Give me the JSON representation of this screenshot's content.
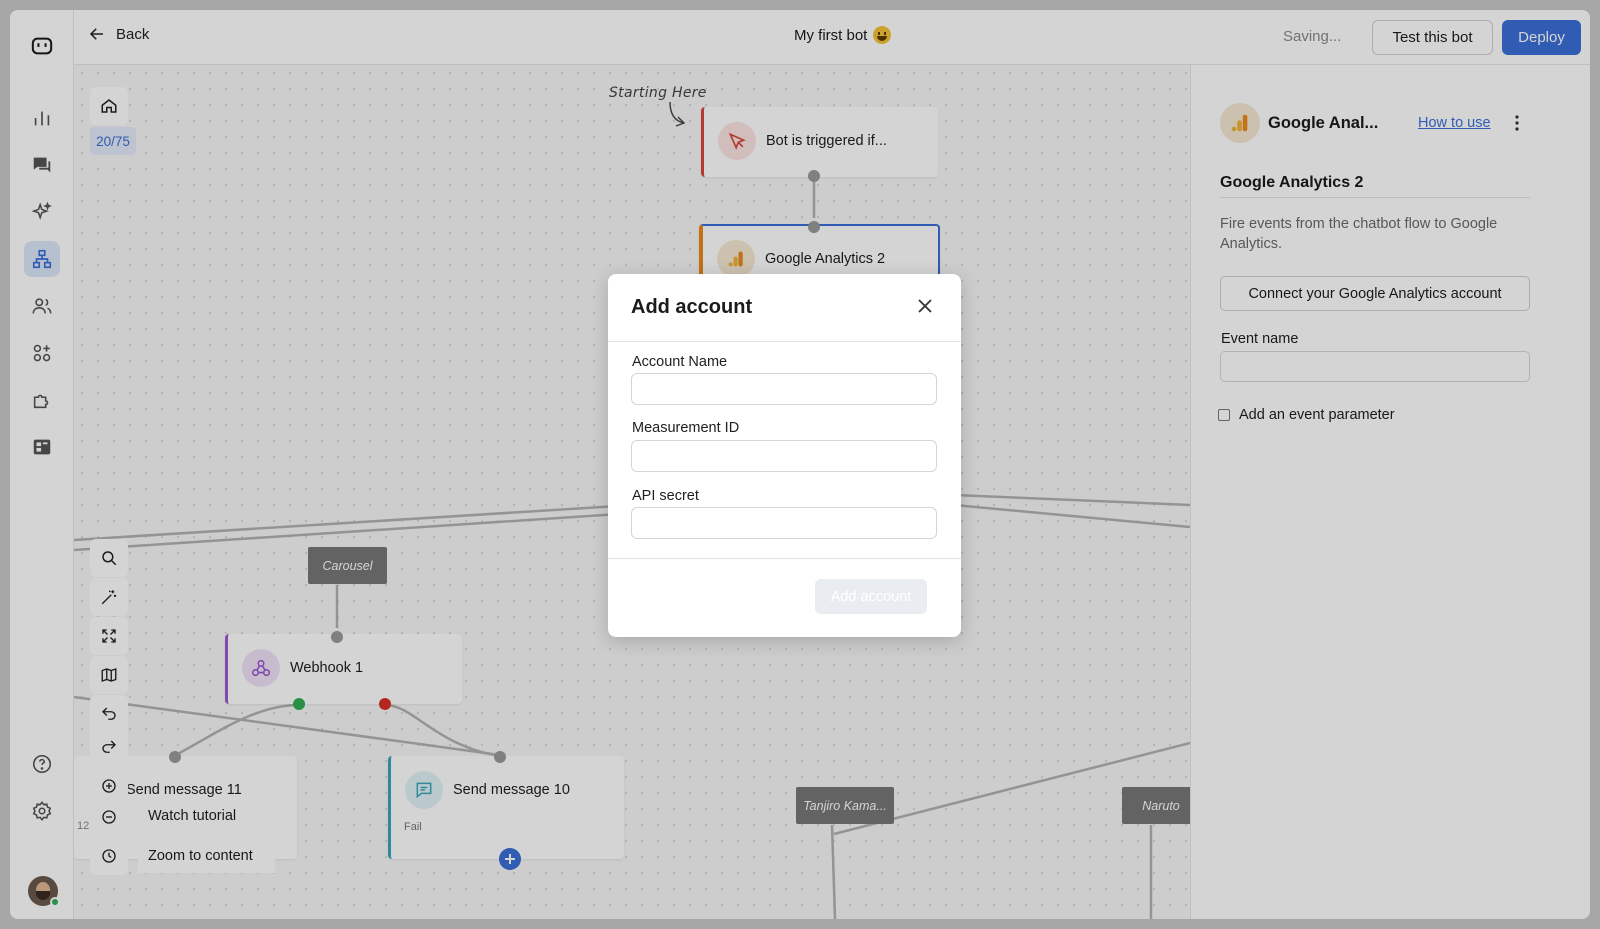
{
  "topbar": {
    "back_label": "Back",
    "bot_title": "My first bot",
    "title_emoji": "smiley-emoji-icon",
    "saving_text": "Saving...",
    "test_label": "Test this bot",
    "deploy_label": "Deploy"
  },
  "rail": {
    "items": [
      "logo-icon",
      "analytics-icon",
      "inbox-icon",
      "ai-sparkle-icon",
      "flow-builder-icon",
      "contacts-icon",
      "integrations-icon",
      "plugin-icon",
      "templates-icon",
      "help-icon",
      "settings-icon"
    ],
    "active": "flow-builder-icon"
  },
  "canvas": {
    "counter": "20/75",
    "annotation": "Starting Here",
    "nodes": {
      "trigger": "Bot is triggered if...",
      "ga": "Google Analytics 2",
      "webhook": "Webhook 1",
      "send11": "Send message 11",
      "send10": "Send message 10",
      "send10_sub": "Fail",
      "left_partial": "12:"
    },
    "tags": {
      "carousel": "Carousel",
      "tanjiro": "Tanjiro Kama...",
      "naruto": "Naruto"
    },
    "menu": {
      "watch_tutorial": "Watch tutorial",
      "zoom_to_content": "Zoom to content"
    }
  },
  "panel": {
    "header_title": "Google Anal...",
    "how_to_use": "How to use",
    "name": "Google Analytics 2",
    "description": "Fire events from the chatbot flow to Google Analytics.",
    "connect_label": "Connect your Google Analytics account",
    "event_name_label": "Event name",
    "event_name_value": "",
    "param_label": "Add an event parameter"
  },
  "modal": {
    "title": "Add account",
    "fields": [
      {
        "label": "Account Name",
        "value": ""
      },
      {
        "label": "Measurement ID",
        "value": ""
      },
      {
        "label": "API secret",
        "value": ""
      }
    ],
    "submit_label": "Add account"
  },
  "colors": {
    "accent": "#3a6fd8",
    "trigger_accent": "#d9463b",
    "webhook_accent": "#9b59d0",
    "message_accent": "#3aa7b8",
    "ga_accent": "#e98a1c",
    "success": "#2fae53",
    "fail": "#d93025"
  }
}
